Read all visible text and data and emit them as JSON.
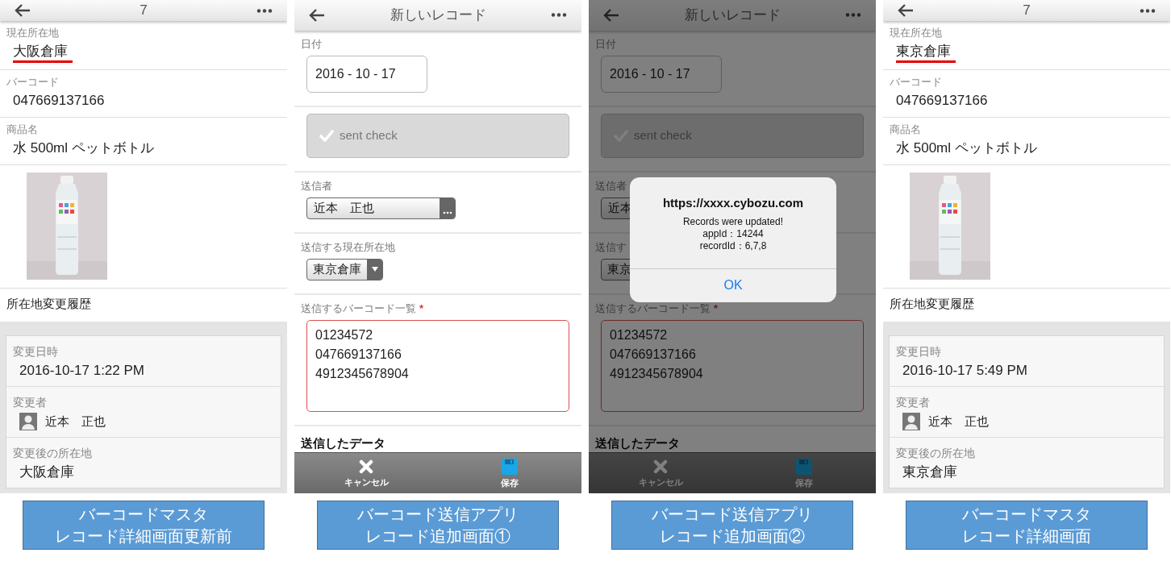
{
  "panels": [
    {
      "kind": "detail",
      "header": {
        "title": "7"
      },
      "fields": [
        {
          "label": "現在所在地",
          "value": "大阪倉庫",
          "underlined": true
        },
        {
          "label": "バーコード",
          "value": "047669137166",
          "underlined": false
        },
        {
          "label": "商品名",
          "value": "水 500ml ペットボトル",
          "underlined": false
        }
      ],
      "photo": {
        "kind": "picture"
      },
      "subtable_title": "所在地変更履歴",
      "history": [
        {
          "kind": "text",
          "label": "変更日時",
          "value": "2016-10-17 1:22 PM"
        },
        {
          "kind": "user",
          "label": "変更者",
          "value": "近本　正也"
        },
        {
          "kind": "text",
          "label": "変更後の所在地",
          "value": "大阪倉庫"
        }
      ],
      "caption": [
        "バーコードマスタ",
        "レコード詳細画面更新前"
      ]
    },
    {
      "kind": "form",
      "dimmed": false,
      "header": {
        "title": "新しいレコード"
      },
      "date": {
        "label": "日付",
        "value": "2016 - 10 - 17"
      },
      "check": {
        "label": "sent check",
        "checked": false,
        "disabled": true
      },
      "sender": {
        "label": "送信者",
        "value": "近本　正也"
      },
      "location": {
        "label": "送信する現在所在地",
        "value": "東京倉庫"
      },
      "barcodes": {
        "label": "送信するバーコード一覧",
        "required_mark": "*",
        "lines": [
          "01234572",
          "047669137166",
          "4912345678904"
        ]
      },
      "section_title": "送信したデータ",
      "toolbar": [
        {
          "kind": "cancel",
          "label": "キャンセル"
        },
        {
          "kind": "save",
          "label": "保存"
        }
      ],
      "caption": [
        "バーコード送信アプリ",
        "レコード追加画面①"
      ]
    },
    {
      "kind": "form",
      "dimmed": true,
      "header": {
        "title": "新しいレコード"
      },
      "date": {
        "label": "日付",
        "value": "2016 - 10 - 17"
      },
      "check": {
        "label": "sent check",
        "checked": false,
        "disabled": true
      },
      "sender": {
        "label": "送信者",
        "value": "近本"
      },
      "location": {
        "label": "送信す",
        "value": "東京"
      },
      "barcodes": {
        "label": "送信するバーコード一覧",
        "required_mark": "*",
        "lines": [
          "01234572",
          "047669137166",
          "4912345678904"
        ]
      },
      "section_title": "送信したデータ",
      "toolbar": [
        {
          "kind": "cancel",
          "label": "キャンセル"
        },
        {
          "kind": "save",
          "label": "保存"
        }
      ],
      "dialog": {
        "title": "https://xxxx.cybozu.com",
        "lines": [
          "Records were updated!",
          "appId：14244",
          "recordId：6,7,8"
        ],
        "button": "OK"
      },
      "caption": [
        "バーコード送信アプリ",
        "レコード追加画面②"
      ]
    },
    {
      "kind": "detail",
      "header": {
        "title": "7"
      },
      "fields": [
        {
          "label": "現在所在地",
          "value": "東京倉庫",
          "underlined": true
        },
        {
          "label": "バーコード",
          "value": "047669137166",
          "underlined": false
        },
        {
          "label": "商品名",
          "value": "水 500ml ペットボトル",
          "underlined": false
        }
      ],
      "photo": {
        "kind": "picture"
      },
      "subtable_title": "所在地変更履歴",
      "history": [
        {
          "kind": "text",
          "label": "変更日時",
          "value": "2016-10-17 5:49 PM"
        },
        {
          "kind": "user",
          "label": "変更者",
          "value": "近本　正也"
        },
        {
          "kind": "text",
          "label": "変更後の所在地",
          "value": "東京倉庫"
        }
      ],
      "caption": [
        "バーコードマスタ",
        "レコード詳細画面"
      ]
    }
  ]
}
